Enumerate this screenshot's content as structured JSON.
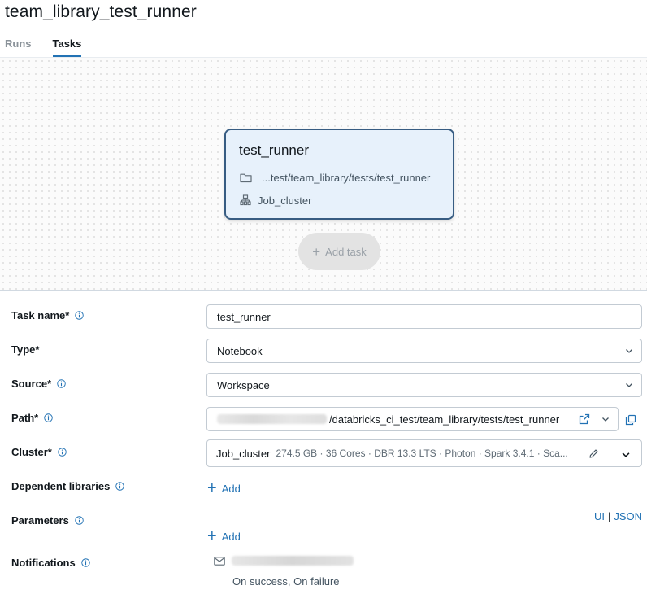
{
  "header": {
    "title": "team_library_test_runner"
  },
  "tabs": [
    {
      "label": "Runs"
    },
    {
      "label": "Tasks"
    }
  ],
  "graph": {
    "node": {
      "title": "test_runner",
      "path": "...test/team_library/tests/test_runner",
      "cluster": "Job_cluster"
    },
    "add_task_label": "Add task"
  },
  "form": {
    "task_name": {
      "label": "Task name*",
      "value": "test_runner"
    },
    "type": {
      "label": "Type*",
      "value": "Notebook"
    },
    "source": {
      "label": "Source*",
      "value": "Workspace"
    },
    "path": {
      "label": "Path*",
      "value": "/databricks_ci_test/team_library/tests/test_runner"
    },
    "cluster": {
      "label": "Cluster*",
      "name": "Job_cluster",
      "details": "274.5 GB · 36 Cores · DBR 13.3 LTS · Photon · Spark 3.4.1 · Sca..."
    },
    "dependent_libraries": {
      "label": "Dependent libraries",
      "add_label": "Add"
    },
    "parameters": {
      "label": "Parameters",
      "add_label": "Add",
      "ui_label": "UI",
      "separator": "|",
      "json_label": "JSON"
    },
    "notifications": {
      "label": "Notifications",
      "status": "On success, On failure"
    }
  },
  "colors": {
    "accent": "#2272b4",
    "node_fill": "#e7f1fb",
    "node_border": "#375c82"
  },
  "icons": [
    "folder-icon",
    "cluster-icon",
    "plus-icon",
    "info-icon",
    "chevron-down-icon",
    "external-link-icon",
    "copy-icon",
    "edit-icon",
    "mail-icon"
  ]
}
